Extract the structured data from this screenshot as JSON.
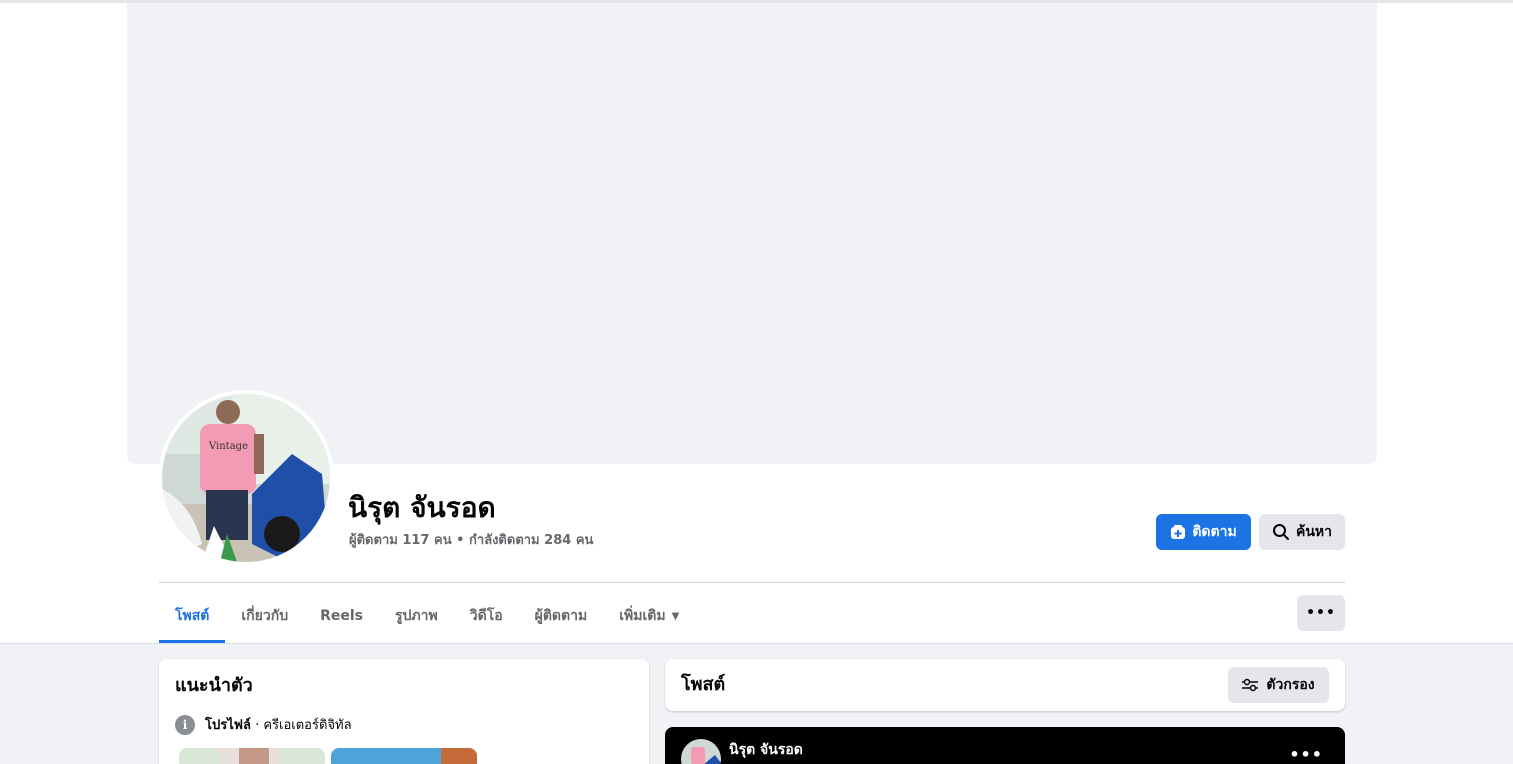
{
  "profile": {
    "name": "นิรุต จันรอด",
    "stats": "ผู้ติดตาม 117 คน • กำลังติดตาม 284 คน"
  },
  "actions": {
    "follow_label": "ติดตาม",
    "search_label": "ค้นหา",
    "more_label": "•••"
  },
  "tabs": [
    {
      "label": "โพสต์",
      "active": true
    },
    {
      "label": "เกี่ยวกับ",
      "active": false
    },
    {
      "label": "Reels",
      "active": false
    },
    {
      "label": "รูปภาพ",
      "active": false
    },
    {
      "label": "วิดีโอ",
      "active": false
    },
    {
      "label": "ผู้ติดตาม",
      "active": false
    },
    {
      "label": "เพิ่มเติม",
      "active": false
    }
  ],
  "intro": {
    "title": "แนะนำตัว",
    "profile_label": "โปรไฟล์",
    "profile_detail": " · ครีเอเตอร์ดิจิทัล"
  },
  "posts": {
    "title": "โพสต์",
    "filter_label": "ตัวกรอง",
    "first_post_author": "นิรุต จันรอด",
    "post_more_label": "•••"
  },
  "colors": {
    "accent": "#1b74e4",
    "cover_bg": "#f0f2f5",
    "feed_bg": "#f0f2f5"
  },
  "icons": {
    "follow": "follow-plus-icon",
    "search": "search-icon",
    "more": "more-dots-icon",
    "filter": "filter-sliders-icon",
    "info": "info-icon",
    "caret": "caret-down-icon"
  }
}
